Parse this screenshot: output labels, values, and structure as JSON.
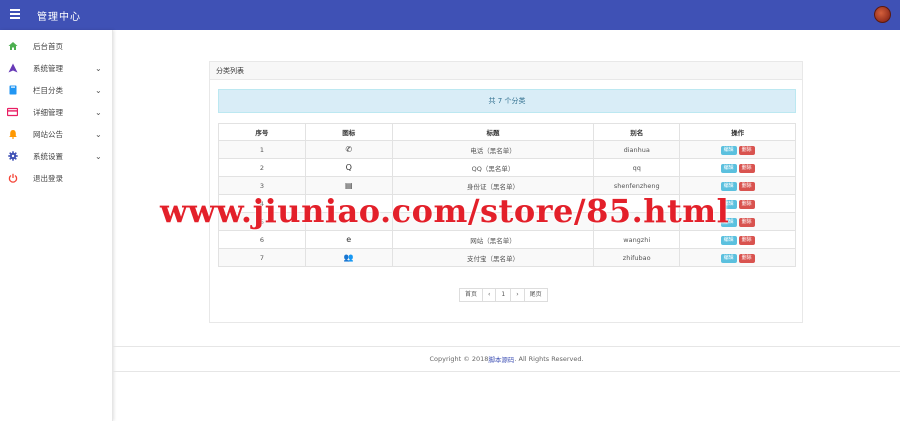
{
  "header": {
    "title": "管理中心"
  },
  "sidebar": {
    "items": [
      {
        "label": "后台首页",
        "icon": "home-icon",
        "color": "#4caf50",
        "has_caret": false
      },
      {
        "label": "系统管理",
        "icon": "triangle-icon",
        "color": "#673ab7",
        "has_caret": true
      },
      {
        "label": "栏目分类",
        "icon": "book-icon",
        "color": "#2196f3",
        "has_caret": true
      },
      {
        "label": "详细管理",
        "icon": "card-icon",
        "color": "#e91e63",
        "has_caret": true
      },
      {
        "label": "网站公告",
        "icon": "bell-icon",
        "color": "#ff9800",
        "has_caret": true
      },
      {
        "label": "系统设置",
        "icon": "gear-icon",
        "color": "#3f51b5",
        "has_caret": true
      },
      {
        "label": "退出登录",
        "icon": "power-icon",
        "color": "#f44336",
        "has_caret": false
      }
    ],
    "caret": "⌄"
  },
  "panel": {
    "title": "分类列表",
    "info": "共 7 个分类"
  },
  "table": {
    "headers": [
      "序号",
      "图标",
      "标题",
      "别名",
      "操作"
    ],
    "edit_label": "编辑",
    "delete_label": "删除",
    "rows": [
      {
        "no": "1",
        "icon": "✆",
        "title": "电话（黑名单）",
        "alias": "dianhua"
      },
      {
        "no": "2",
        "icon": "Q",
        "title": "QQ（黑名单）",
        "alias": "qq"
      },
      {
        "no": "3",
        "icon": "▤",
        "title": "身份证（黑名单）",
        "alias": "shenfenzheng"
      },
      {
        "no": "4",
        "icon": "",
        "title": "",
        "alias": ""
      },
      {
        "no": "5",
        "icon": "",
        "title": "",
        "alias": ""
      },
      {
        "no": "6",
        "icon": "e",
        "title": "网站（黑名单）",
        "alias": "wangzhi"
      },
      {
        "no": "7",
        "icon": "👥",
        "title": "支付宝（黑名单）",
        "alias": "zhifubao"
      }
    ]
  },
  "pagination": {
    "first": "首页",
    "prev": "‹",
    "current": "1",
    "next": "›",
    "last": "尾页"
  },
  "footer": {
    "prefix": "Copyright © 2018 ",
    "link": "脚本源码",
    "suffix": ". All Rights Reserved."
  },
  "watermark": "www.jiuniao.com/store/85.html",
  "colors": {
    "topbar": "#3f51b5",
    "info_bg": "#d9edf7",
    "edit": "#5bc0de",
    "delete": "#d9534f",
    "watermark": "#e3202a"
  }
}
